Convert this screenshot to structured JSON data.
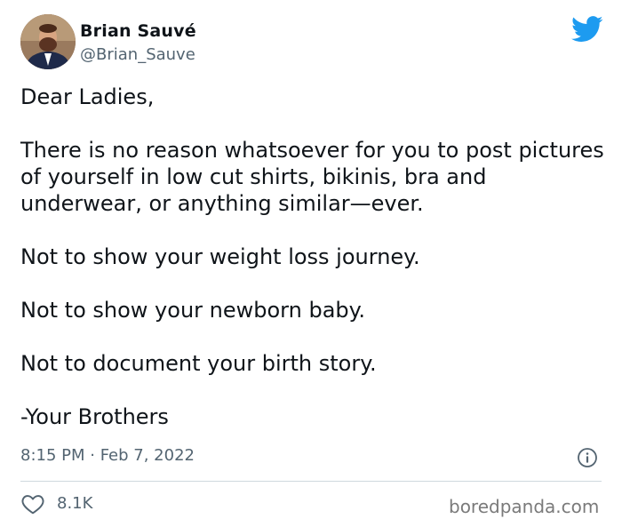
{
  "author": {
    "name": "Brian Sauvé",
    "handle": "@Brian_Sauve"
  },
  "icons": {
    "brand": "twitter-bird-icon",
    "info": "info-icon",
    "like": "heart-icon"
  },
  "colors": {
    "brand_blue": "#1d9bf0",
    "text": "#0f1419",
    "muted": "#536471"
  },
  "tweet": {
    "paragraphs": [
      "Dear Ladies,",
      "There is no reason whatsoever for you to post pictures of yourself in low cut shirts, bikinis, bra and underwear, or anything similar—ever.",
      "Not to show your weight loss journey.",
      "Not to show your newborn baby.",
      "Not to document your birth story.",
      "-Your Brothers"
    ],
    "timestamp": "8:15 PM · Feb 7, 2022"
  },
  "stats": {
    "likes": "8.1K"
  },
  "watermark": "boredpanda.com"
}
